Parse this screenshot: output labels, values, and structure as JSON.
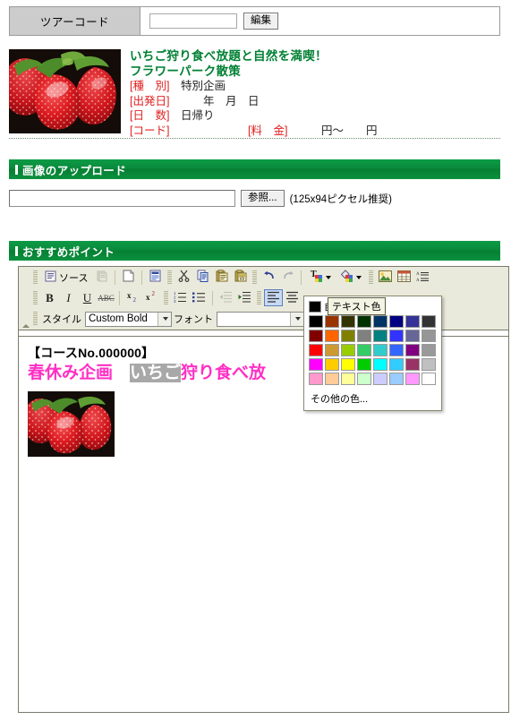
{
  "tourcode": {
    "label": "ツアーコード",
    "input_value": "",
    "input_placeholder": "",
    "edit_button": "編集"
  },
  "summary": {
    "title": "いちご狩り食べ放題と自然を満喫！",
    "subtitle": "フラワーパーク散策",
    "rows": [
      {
        "label": "[種　別]",
        "value": "特別企画"
      },
      {
        "label": "[出発日]",
        "value": "　　年　月　日"
      },
      {
        "label": "[日　数]",
        "value": "日帰り"
      }
    ],
    "code_label": "[コード]",
    "code_value": "",
    "price_label": "[料　金]",
    "price_value": "　円～　　円",
    "thumb_alt": "strawberry-photo"
  },
  "upload_section": {
    "heading": "画像のアップロード",
    "input_value": "",
    "browse_button": "参照...",
    "hint": "(125x94ピクセル推奨)"
  },
  "point_section": {
    "heading": "おすすめポイント"
  },
  "editor": {
    "toolbar_row1": [
      {
        "name": "source-button",
        "label": "ソース",
        "icon": "source-icon"
      },
      {
        "name": "paste-button",
        "icon": "paste-icon",
        "disabled": true
      },
      {
        "name": "new-page-button",
        "icon": "new-page-icon"
      },
      {
        "name": "templates-button",
        "icon": "templates-icon"
      },
      {
        "name": "cut-button",
        "icon": "scissors-icon"
      },
      {
        "name": "copy-button",
        "icon": "copy-icon"
      },
      {
        "name": "paste-plain-button",
        "icon": "paste-plain-icon"
      },
      {
        "name": "paste-word-button",
        "icon": "paste-word-icon"
      },
      {
        "name": "undo-button",
        "icon": "undo-arrow-icon"
      },
      {
        "name": "redo-button",
        "icon": "redo-arrow-icon",
        "disabled": true
      },
      {
        "name": "text-color-button",
        "icon": "text-color-icon",
        "active": true
      },
      {
        "name": "bg-color-button",
        "icon": "bg-color-icon"
      },
      {
        "name": "insert-image-button",
        "icon": "image-icon"
      },
      {
        "name": "insert-table-button",
        "icon": "table-icon"
      },
      {
        "name": "line-height-button",
        "icon": "line-height-icon"
      }
    ],
    "toolbar_row2": [
      {
        "name": "bold-button",
        "label": "B"
      },
      {
        "name": "italic-button",
        "label": "I"
      },
      {
        "name": "underline-button",
        "label": "U"
      },
      {
        "name": "strike-button",
        "label": "ABC"
      },
      {
        "name": "subscript-button",
        "label": "x2"
      },
      {
        "name": "superscript-button",
        "label": "x2"
      },
      {
        "name": "numbered-list-button",
        "icon": "numbered-list-icon"
      },
      {
        "name": "bulleted-list-button",
        "icon": "bulleted-list-icon"
      },
      {
        "name": "outdent-button",
        "icon": "outdent-icon",
        "disabled": true
      },
      {
        "name": "indent-button",
        "icon": "indent-icon"
      },
      {
        "name": "align-left-button",
        "icon": "align-left-icon",
        "active": true
      },
      {
        "name": "align-center-button",
        "icon": "align-center-icon"
      }
    ],
    "style_label": "スタイル",
    "style_value": "Custom Bold",
    "font_label": "フォント",
    "font_value": "",
    "content": {
      "line1": "【コースNo.000000】",
      "line2_part1": "春休み企画　",
      "line2_selected": "いちご",
      "line2_part2": "狩り食べ放",
      "image_alt": "strawberry-photo"
    }
  },
  "color_palette": {
    "tooltip": "テキスト色",
    "auto_swatch": "#000000",
    "auto_label": "自動",
    "more_colors": "その他の色...",
    "colors": [
      [
        "#000000",
        "#993300",
        "#333300",
        "#003300",
        "#003366",
        "#000080",
        "#333399",
        "#333333"
      ],
      [
        "#800000",
        "#FF6600",
        "#808000",
        "#808080",
        "#008080",
        "#3333FF",
        "#666699",
        "#969696"
      ],
      [
        "#FF0000",
        "#CC9933",
        "#99CC00",
        "#33CC66",
        "#33CCCC",
        "#3366FF",
        "#800080",
        "#999999"
      ],
      [
        "#FF00FF",
        "#FFCC00",
        "#FFFF00",
        "#00CC00",
        "#00FFFF",
        "#33CCFF",
        "#993366",
        "#C0C0C0"
      ],
      [
        "#FF99CC",
        "#FFCC99",
        "#FFFF99",
        "#CCFFCC",
        "#CCCCFF",
        "#99CCFF",
        "#FF99FF",
        "#FFFFFF"
      ]
    ]
  }
}
